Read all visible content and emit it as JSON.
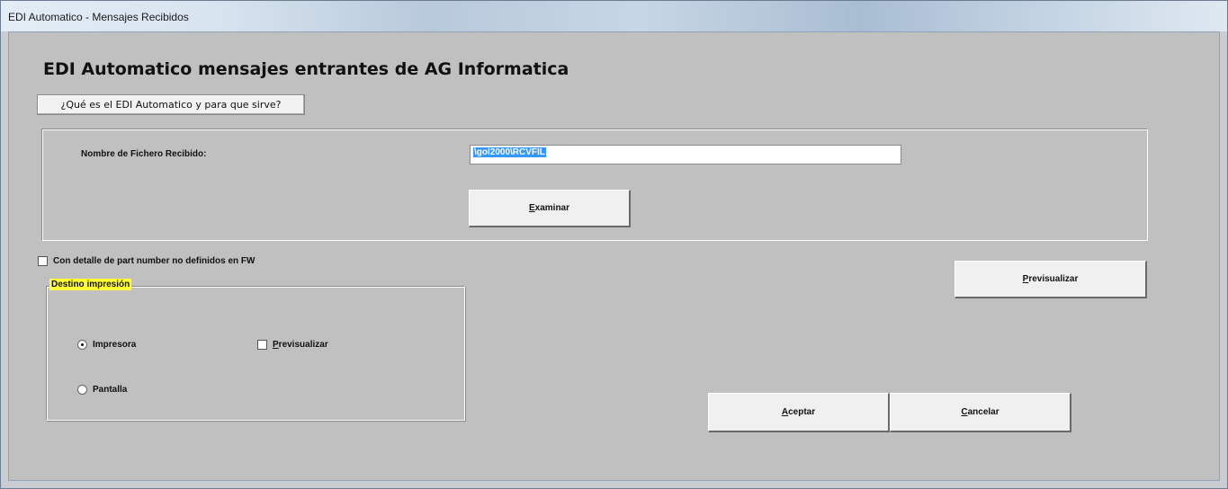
{
  "window": {
    "title": "EDI Automatico - Mensajes Recibidos"
  },
  "main": {
    "heading": "EDI Automatico mensajes entrantes de AG Informatica",
    "help_button": "¿Qué es el EDI Automatico y para que sirve?"
  },
  "file": {
    "label": "Nombre de Fichero Recibido:",
    "value": "\\gol2000\\RCVFIL",
    "browse_button": {
      "mnemonic": "E",
      "rest": "xaminar"
    }
  },
  "detail_checkbox": {
    "label": "Con detalle de part number no definidos en FW",
    "checked": false
  },
  "print_dest": {
    "label": "Destino impresión",
    "options": [
      {
        "label": "Impresora",
        "selected": true
      },
      {
        "label": "Pantalla",
        "selected": false
      }
    ],
    "preview_checkbox": {
      "mnemonic": "P",
      "rest": "revisualizar",
      "checked": false
    }
  },
  "buttons": {
    "preview": {
      "mnemonic": "P",
      "rest": "revisualizar"
    },
    "accept": {
      "mnemonic": "A",
      "rest": "ceptar"
    },
    "cancel": {
      "mnemonic": "C",
      "rest": "ancelar"
    }
  }
}
